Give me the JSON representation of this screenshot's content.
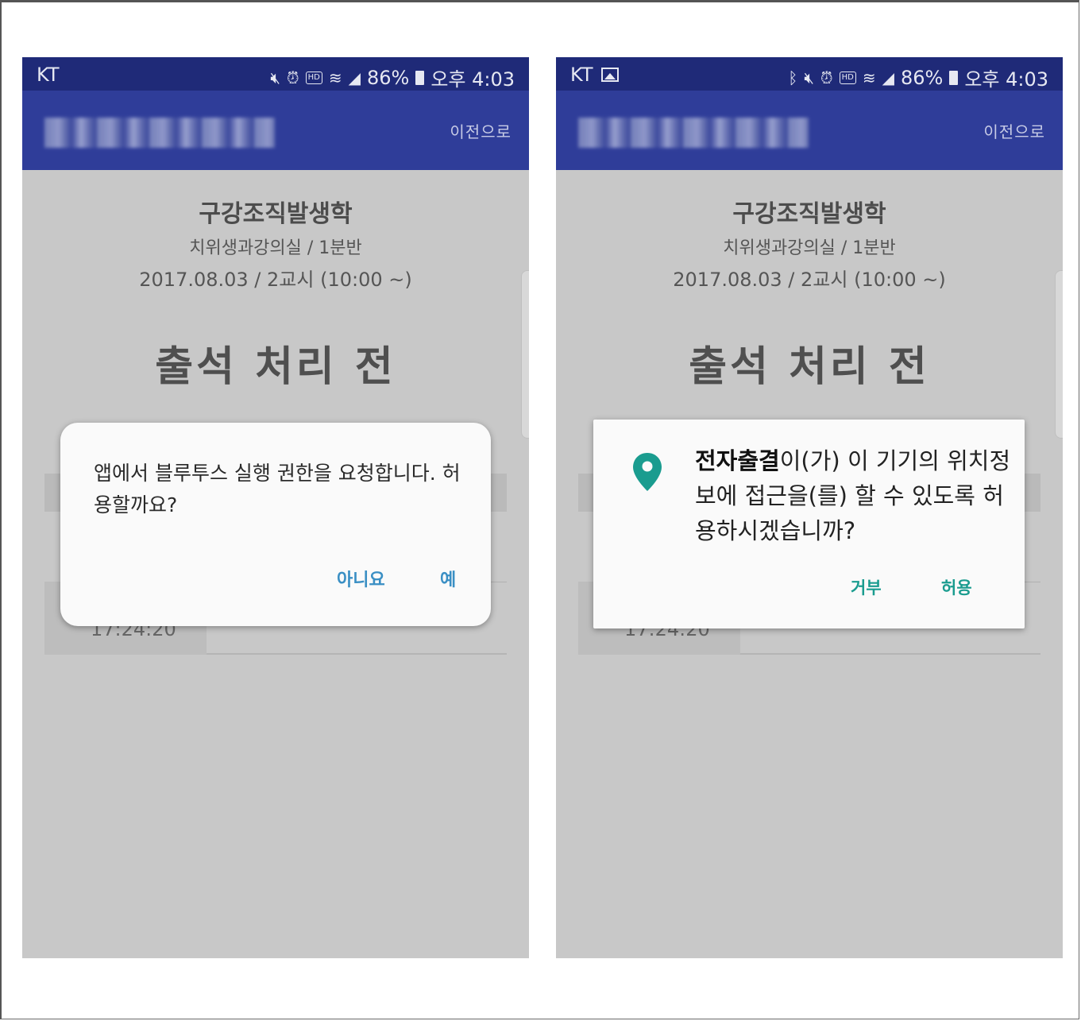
{
  "left_screen": {
    "status_bar": {
      "carrier": "KT",
      "battery": "86%",
      "time": "오후 4:03",
      "icons": [
        "mute-icon",
        "alarm-icon",
        "hd-icon",
        "wifi-icon",
        "signal-icon",
        "battery-icon"
      ]
    },
    "app_bar": {
      "back_label": "이전으로"
    },
    "course": {
      "title": "구강조직발생학",
      "room": "치위생과강의실 / 1분반",
      "date": "2017.08.03 / 2교시 (10:00 ~)"
    },
    "attendance_status": "출석 처리 전",
    "background_time": "17:24:20",
    "dialog": {
      "message": "앱에서 블루투스 실행 권한을 요청합니다. 허용할까요?",
      "no_label": "아니요",
      "yes_label": "예",
      "button_color": "#3a8fc4"
    }
  },
  "right_screen": {
    "status_bar": {
      "carrier": "KT",
      "battery": "86%",
      "time": "오후 4:03",
      "icons": [
        "gallery-icon",
        "bluetooth-icon",
        "mute-icon",
        "alarm-icon",
        "hd-icon",
        "wifi-icon",
        "signal-icon",
        "battery-icon"
      ]
    },
    "app_bar": {
      "back_label": "이전으로"
    },
    "course": {
      "title": "구강조직발생학",
      "room": "치위생과강의실 / 1분반",
      "date": "2017.08.03 / 2교시 (10:00 ~)"
    },
    "attendance_status": "출석 처리 전",
    "background_time": "17:24:20",
    "dialog": {
      "app_name": "전자출결",
      "message_rest": "이(가) 이 기기의 위치정보에 접근을(를) 할 수 있도록 허용하시겠습니까?",
      "deny_label": "거부",
      "allow_label": "허용",
      "icon": "location-pin-icon",
      "accent_color": "#1a9c8f"
    }
  },
  "colors": {
    "status_bar": "#1f2a78",
    "app_bar": "#2f3d99",
    "dim_background": "#c8c8c8"
  }
}
